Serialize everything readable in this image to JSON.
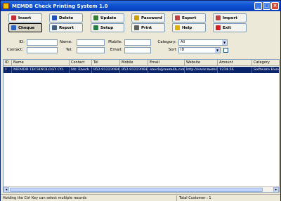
{
  "window": {
    "title": "MEMDB Check Printing System 1.0",
    "controls": [
      "_",
      "□",
      "×"
    ]
  },
  "toolbar": {
    "row1": [
      {
        "label": "Insert",
        "icon": "insert-icon",
        "color": "#c03030"
      },
      {
        "label": "Delete",
        "icon": "delete-icon",
        "color": "#2050c0"
      },
      {
        "label": "Update",
        "icon": "update-icon",
        "color": "#308030"
      },
      {
        "label": "Password",
        "icon": "key-icon",
        "color": "#d0a000"
      },
      {
        "label": "Export",
        "icon": "export-icon",
        "color": "#c04040"
      },
      {
        "label": "Import",
        "icon": "import-icon",
        "color": "#c04040"
      }
    ],
    "row2": [
      {
        "label": "Cheque",
        "icon": "cheque-icon",
        "color": "#3060c0"
      },
      {
        "label": "Report",
        "icon": "report-icon",
        "color": "#406080"
      },
      {
        "label": "Setup",
        "icon": "setup-icon",
        "color": "#208040"
      },
      {
        "label": "Print",
        "icon": "print-icon",
        "color": "#606060"
      },
      {
        "label": "Help",
        "icon": "help-icon",
        "color": "#e0b000"
      },
      {
        "label": "Exit",
        "icon": "exit-icon",
        "color": "#d02020"
      }
    ]
  },
  "filters": {
    "id_label": "ID:",
    "id_value": "",
    "name_label": "Name:",
    "name_value": "",
    "mobile_label": "Mobile:",
    "mobile_value": "",
    "category_label": "Category:",
    "category_value": "All",
    "contact_label": "Contact:",
    "contact_value": "",
    "tel_label": "Tel:",
    "tel_value": "",
    "email_label": "Email:",
    "email_value": "",
    "sort_label": "Sort",
    "sort_value": "ID"
  },
  "grid": {
    "columns": [
      "ID",
      "Name",
      "Contact",
      "Tel",
      "Mobile",
      "Email",
      "Website",
      "Amount",
      "Category"
    ],
    "rows": [
      [
        "1",
        "MEMDB TECHNOLOGY CO.",
        "Mr. Enock",
        "852-93223064",
        "852-93223064",
        "enock@memdb.com",
        "http://www.memdb",
        "1234.56",
        "Software House"
      ]
    ]
  },
  "status": {
    "hint": "Holding the Ctrl Key can select multiple records",
    "total": "Total Customer : 1"
  }
}
